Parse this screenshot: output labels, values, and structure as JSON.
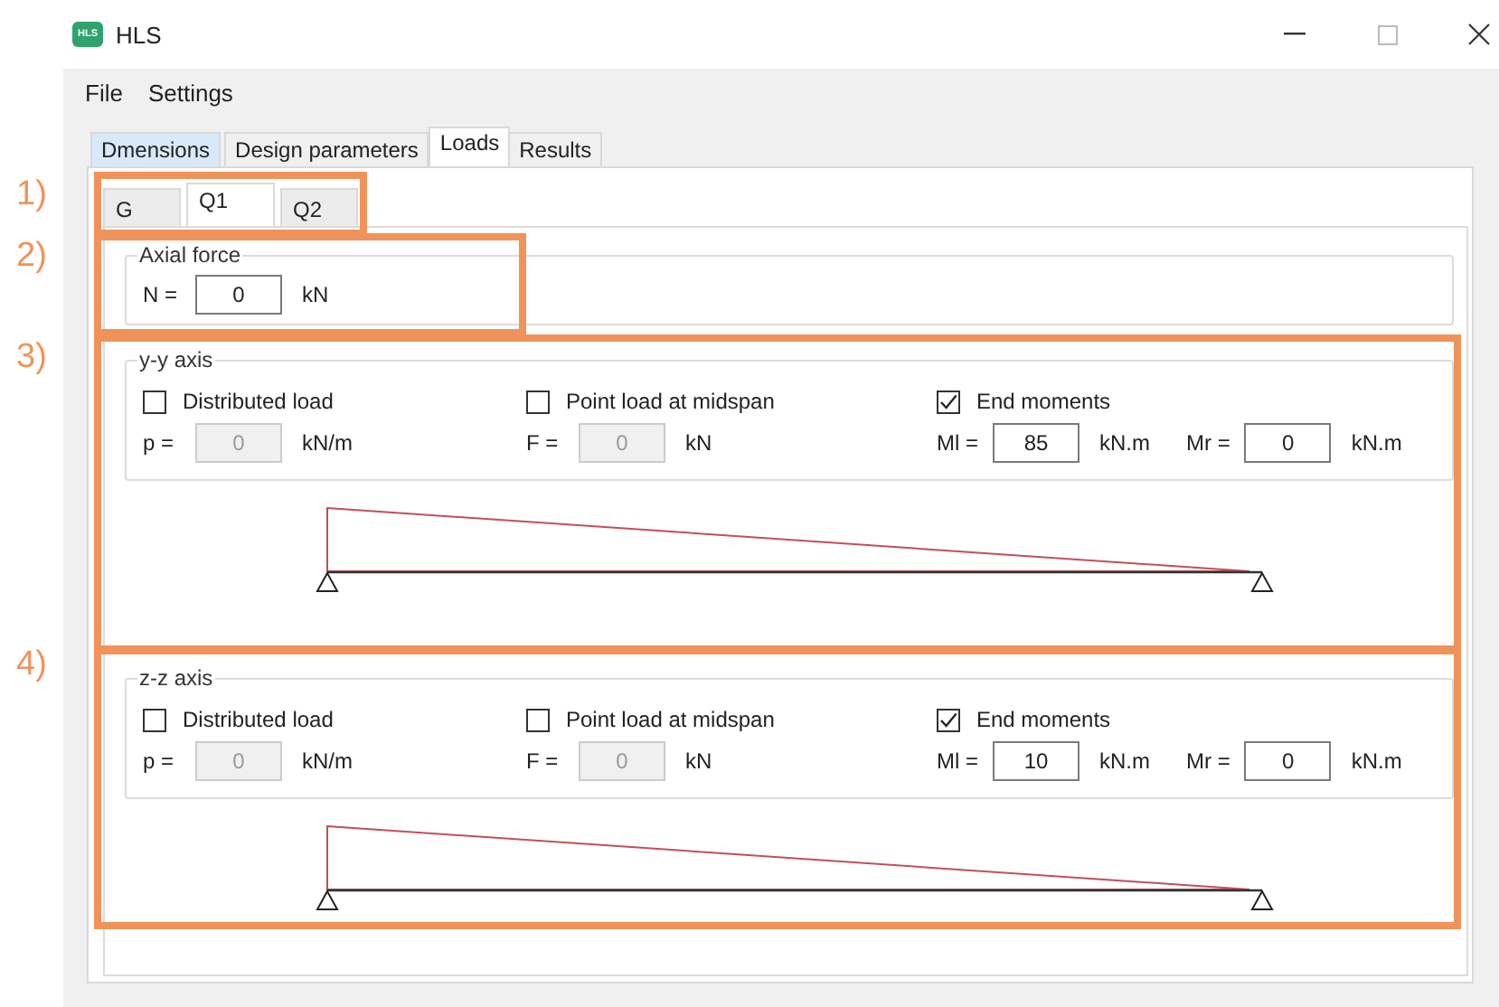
{
  "window": {
    "title": "HLS",
    "icon_text": "HLS"
  },
  "menu": [
    "File",
    "Settings"
  ],
  "tabs": [
    {
      "label": "Dmensions",
      "selected": false,
      "hovered": true
    },
    {
      "label": "Design parameters",
      "selected": false,
      "hovered": false
    },
    {
      "label": "Loads",
      "selected": true,
      "hovered": false
    },
    {
      "label": "Results",
      "selected": false,
      "hovered": false
    }
  ],
  "load_cases": [
    {
      "label": "G",
      "selected": false
    },
    {
      "label": "Q1",
      "selected": true
    },
    {
      "label": "Q2",
      "selected": false
    }
  ],
  "axial_force": {
    "title": "Axial force",
    "fields": [
      {
        "label": "N =",
        "value": "0",
        "unit": "kN",
        "disabled": false
      }
    ]
  },
  "axes": [
    {
      "title": "y-y axis",
      "loads": [
        {
          "label": "Distributed load",
          "checked": false,
          "fields": [
            {
              "label": "p =",
              "value": "0",
              "unit": "kN/m",
              "disabled": true
            }
          ]
        },
        {
          "label": "Point load at midspan",
          "checked": false,
          "fields": [
            {
              "label": "F =",
              "value": "0",
              "unit": "kN",
              "disabled": true
            }
          ]
        },
        {
          "label": "End moments",
          "checked": true,
          "fields": [
            {
              "label": "Ml =",
              "value": "85",
              "unit": "kN.m",
              "disabled": false
            },
            {
              "label": "Mr =",
              "value": "0",
              "unit": "kN.m",
              "disabled": false
            }
          ]
        }
      ]
    },
    {
      "title": "z-z axis",
      "loads": [
        {
          "label": "Distributed load",
          "checked": false,
          "fields": [
            {
              "label": "p =",
              "value": "0",
              "unit": "kN/m",
              "disabled": true
            }
          ]
        },
        {
          "label": "Point load at midspan",
          "checked": false,
          "fields": [
            {
              "label": "F =",
              "value": "0",
              "unit": "kN",
              "disabled": true
            }
          ]
        },
        {
          "label": "End moments",
          "checked": true,
          "fields": [
            {
              "label": "Ml =",
              "value": "10",
              "unit": "kN.m",
              "disabled": false
            },
            {
              "label": "Mr =",
              "value": "0",
              "unit": "kN.m",
              "disabled": false
            }
          ]
        }
      ]
    }
  ],
  "annotations": [
    {
      "label": "1)"
    },
    {
      "label": "2)"
    },
    {
      "label": "3)"
    },
    {
      "label": "4)"
    }
  ]
}
